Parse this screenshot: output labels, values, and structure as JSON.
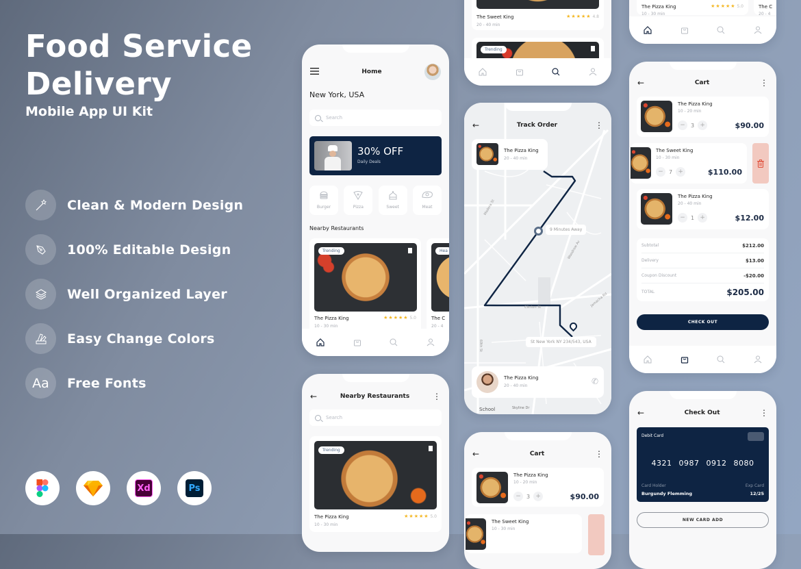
{
  "hero": {
    "title_line1": "Food Service",
    "title_line2": "Delivery",
    "subtitle": "Mobile App UI Kit"
  },
  "features": [
    {
      "icon": "magic-wand-icon",
      "label": "Clean & Modern Design"
    },
    {
      "icon": "pen-tool-icon",
      "label": "100% Editable Design"
    },
    {
      "icon": "layers-icon",
      "label": "Well Organized Layer"
    },
    {
      "icon": "color-swatch-icon",
      "label": "Easy Change Colors"
    },
    {
      "icon": "font-icon",
      "glyph": "Aa",
      "label": "Free Fonts"
    }
  ],
  "tools": [
    {
      "name": "figma-icon"
    },
    {
      "name": "sketch-icon"
    },
    {
      "name": "xd-icon",
      "label": "Xd"
    },
    {
      "name": "photoshop-icon",
      "label": "Ps"
    }
  ],
  "colors": {
    "navy": "#0e2443",
    "star": "#f4b723",
    "delete": "#f2c9c0",
    "delete_icon": "#e0533f"
  },
  "home": {
    "title": "Home",
    "location": "New York, USA",
    "search_placeholder": "Search",
    "promo": {
      "headline": "30% OFF",
      "sub": "Daily Deals"
    },
    "categories": [
      "Burger",
      "Pizza",
      "Sweet",
      "Meat"
    ],
    "section": "Nearby Restaurants",
    "restaurants": [
      {
        "badge": "Trending",
        "name": "The Pizza King",
        "rating": "5.0",
        "time": "10 - 30 min"
      },
      {
        "badge": "Hea",
        "name": "The C",
        "time": "20 - 4"
      }
    ]
  },
  "nearby": {
    "title": "Nearby Restaurants",
    "search_placeholder": "Search",
    "items": [
      {
        "badge": "Trending",
        "name": "The Pizza King",
        "rating": "5.0",
        "time": "10 - 30 min"
      }
    ]
  },
  "search_screen": {
    "items": [
      {
        "name": "The Sweet King",
        "rating": "4.8",
        "time": "20 - 40 min"
      },
      {
        "badge": "Trending"
      }
    ]
  },
  "track": {
    "title": "Track Order",
    "restaurant": {
      "name": "The Pizza King",
      "time": "20 - 40 min"
    },
    "eta": "9 Minutes Away",
    "address": "St New York NY 234/543, USA",
    "driver": {
      "name": "The Pizza King",
      "time": "20 - 40 min"
    },
    "streets": [
      "Madera St",
      "Woodrow Av",
      "Clinton St",
      "Jamacha Rd",
      "69th St",
      "Skyline Dr",
      "School"
    ]
  },
  "top_right": {
    "name": "The Pizza King",
    "rating": "5.0",
    "time": "10 - 30 min",
    "second": "The C",
    "second_time": "20 - 4"
  },
  "cart": {
    "title": "Cart",
    "items": [
      {
        "name": "The Pizza King",
        "time": "10 - 20 min",
        "qty": "3",
        "price": "$90.00"
      },
      {
        "name": "The Sweet King",
        "time": "10 - 30 min",
        "qty": "7",
        "price": "$110.00"
      },
      {
        "name": "The Pizza King",
        "time": "20 - 40 min",
        "qty": "1",
        "price": "$12.00"
      }
    ],
    "summary": [
      {
        "label": "Subtotal",
        "value": "$212.00"
      },
      {
        "label": "Delivery",
        "value": "$13.00"
      },
      {
        "label": "Coupon Discount",
        "value": "-$20.00"
      }
    ],
    "total_label": "TOTAL",
    "total_value": "$205.00",
    "checkout_label": "CHECK OUT"
  },
  "cart_bottom": {
    "title": "Cart",
    "items": [
      {
        "name": "The Pizza King",
        "time": "10 - 20 min",
        "qty": "3",
        "price": "$90.00"
      },
      {
        "name": "The Sweet King",
        "time": "10 - 30 min"
      }
    ]
  },
  "checkout": {
    "title": "Check Out",
    "card_type": "Debit Card",
    "card_number": [
      "4321",
      "0987",
      "0912",
      "8080"
    ],
    "holder_label": "Card Holder",
    "holder": "Burgundy Flemming",
    "exp_label": "Exp Card",
    "exp": "12/25",
    "new_card_label": "NEW CARD ADD"
  }
}
